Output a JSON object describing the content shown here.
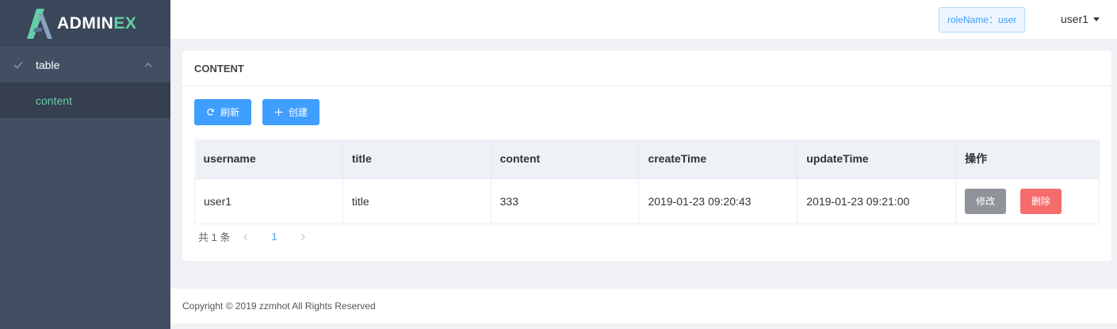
{
  "brand": {
    "name_main": "ADMIN",
    "name_accent": "EX",
    "accent_color": "#65cea7"
  },
  "sidebar": {
    "group": {
      "label": "table",
      "icon": "check-icon",
      "chevron": "chevron-up-icon"
    },
    "items": [
      {
        "label": "content",
        "active": true
      }
    ]
  },
  "header": {
    "role_badge": "roleName：user",
    "user": "user1"
  },
  "card": {
    "title": "CONTENT",
    "refresh_label": "刷新",
    "create_label": "创建"
  },
  "table": {
    "columns": [
      "username",
      "title",
      "content",
      "createTime",
      "updateTime",
      "操作"
    ],
    "rows": [
      {
        "username": "user1",
        "title": "title",
        "content": "333",
        "createTime": "2019-01-23 09:20:43",
        "updateTime": "2019-01-23 09:21:00"
      }
    ],
    "edit_label": "修改",
    "delete_label": "删除"
  },
  "pager": {
    "total": "共 1 条",
    "current": "1"
  },
  "footer": {
    "copyright": "Copyright © 2019 zzmhot All Rights Reserved"
  },
  "colors": {
    "primary": "#409eff",
    "danger": "#f56c6c",
    "info": "#909399",
    "sidebar": "#424f63"
  }
}
